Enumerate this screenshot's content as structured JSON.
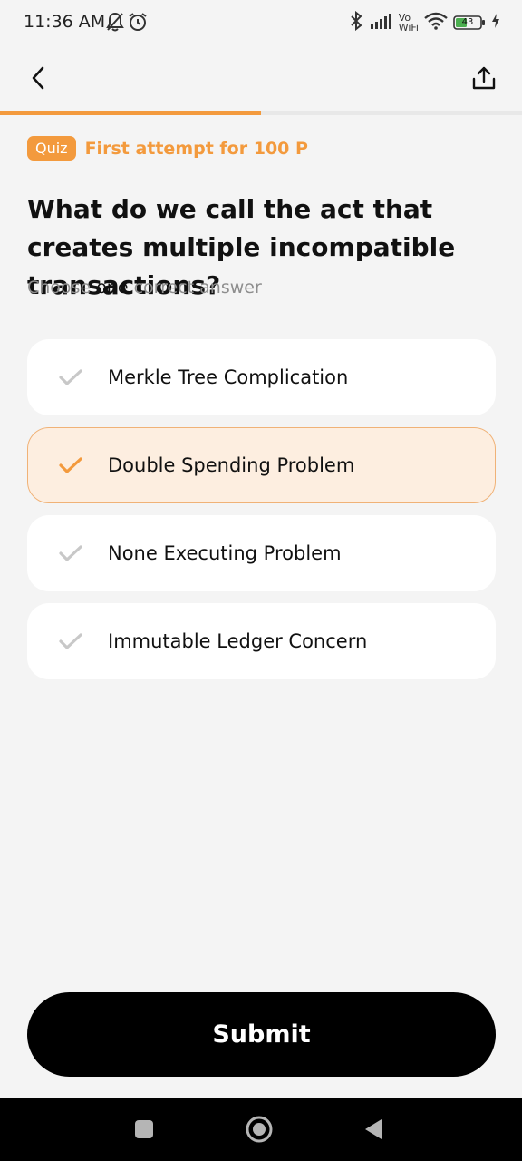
{
  "status_bar": {
    "time": "11:36 AM",
    "network_label_top": "Vo",
    "network_label_bottom": "WiFi",
    "battery_level": "43",
    "icons": [
      "mute-icon",
      "alarm-icon",
      "bluetooth-icon",
      "signal-icon",
      "wifi-icon",
      "battery-icon",
      "charging-icon"
    ]
  },
  "header": {
    "back_icon": "back-arrow-icon",
    "share_icon": "share-icon",
    "progress_fraction": 0.5
  },
  "quiz": {
    "badge": "Quiz",
    "reward_text": "First attempt for 100 P",
    "question": "What do we call the act that creates multiple incompatible transactions?",
    "instruction_prefix": "Choose ",
    "instruction_emphasis": "one",
    "instruction_suffix": " correct answer",
    "options": [
      {
        "label": "Merkle Tree Complication",
        "selected": false
      },
      {
        "label": "Double Spending Problem",
        "selected": true
      },
      {
        "label": "None Executing Problem",
        "selected": false
      },
      {
        "label": "Immutable Ledger Concern",
        "selected": false
      }
    ]
  },
  "submit": {
    "label": "Submit"
  },
  "nav_bar": {
    "icons": [
      "recents-icon",
      "home-icon",
      "back-icon"
    ]
  },
  "colors": {
    "accent": "#f39a3d",
    "selected_bg": "#fdeee0",
    "background": "#f4f4f4",
    "unselected_check": "#c8c8c8"
  }
}
